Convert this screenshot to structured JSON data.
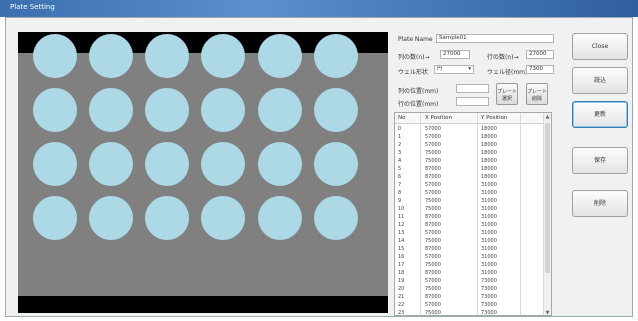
{
  "window": {
    "title": "Plate Setting"
  },
  "plate": {
    "rows": 4,
    "cols": 6,
    "well_color": "#add8e6",
    "background_color": "#808080",
    "band_color": "#000000"
  },
  "form": {
    "plate_name_label": "Plate Name",
    "plate_name_value": "Sample01",
    "field1_label": "列の数(n)→",
    "field1_value": "27000",
    "field2_label": "行の数(n)→",
    "field2_value": "27000",
    "field3_label": "ウェル形状",
    "field3_value": "円",
    "field4_label": "ウェル径(mm)",
    "field4_value": "7300",
    "field5_label": "列の位置(mm)",
    "field6_label": "行の位置(mm)",
    "btn_a_label": "プレート\n選択",
    "btn_b_label": "プレート\n削除"
  },
  "table": {
    "headers": [
      "No",
      "X Position",
      "Y Position"
    ],
    "rows": [
      [
        "0",
        "57000",
        "18000"
      ],
      [
        "1",
        "57000",
        "18000"
      ],
      [
        "2",
        "57000",
        "18000"
      ],
      [
        "3",
        "75000",
        "18000"
      ],
      [
        "4",
        "75000",
        "18000"
      ],
      [
        "5",
        "87000",
        "18000"
      ],
      [
        "6",
        "87000",
        "18000"
      ],
      [
        "7",
        "57000",
        "31000"
      ],
      [
        "8",
        "57000",
        "31000"
      ],
      [
        "9",
        "75000",
        "31000"
      ],
      [
        "10",
        "75000",
        "31000"
      ],
      [
        "11",
        "87000",
        "31000"
      ],
      [
        "12",
        "87000",
        "31000"
      ],
      [
        "13",
        "57000",
        "31000"
      ],
      [
        "14",
        "75000",
        "31000"
      ],
      [
        "15",
        "87000",
        "31000"
      ],
      [
        "16",
        "57000",
        "31000"
      ],
      [
        "17",
        "75000",
        "31000"
      ],
      [
        "18",
        "87000",
        "31000"
      ],
      [
        "19",
        "57000",
        "73000"
      ],
      [
        "20",
        "75000",
        "73000"
      ],
      [
        "21",
        "87000",
        "73000"
      ],
      [
        "22",
        "57000",
        "73000"
      ],
      [
        "23",
        "75000",
        "73000"
      ]
    ]
  },
  "side_buttons": [
    {
      "label": "Close"
    },
    {
      "label": "読込"
    },
    {
      "label": "更新"
    },
    {
      "label": "保存"
    },
    {
      "label": "削除"
    }
  ]
}
